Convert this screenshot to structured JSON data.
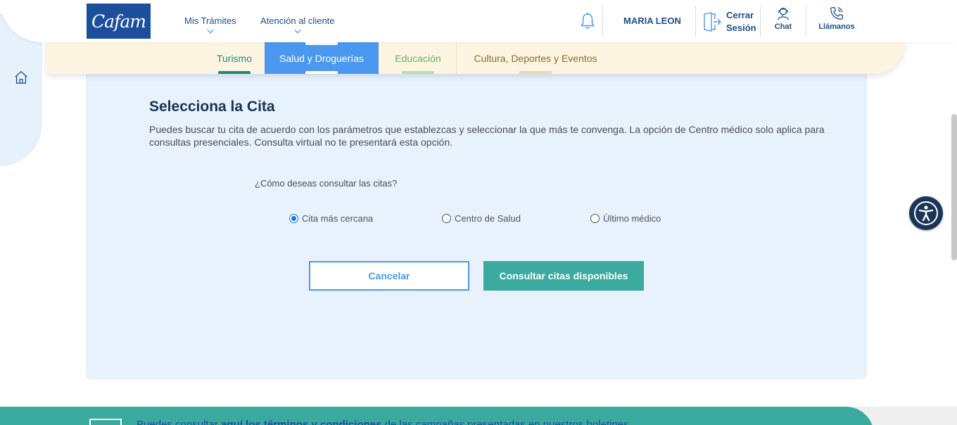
{
  "header": {
    "logo_text": "Cafam",
    "nav": [
      {
        "label": "Mis Trámites"
      },
      {
        "label": "Atención al cliente"
      }
    ],
    "user_name": "MARIA LEON",
    "logout_label": "Cerrar Sesión",
    "chat_label": "Chat",
    "call_label": "Llámanos"
  },
  "categories": [
    {
      "label": "Turismo",
      "color": "#1e8a7e"
    },
    {
      "label": "Salud y Droguerías",
      "color": "#ffffff",
      "active": true
    },
    {
      "label": "Educación",
      "color": "#5cb85c"
    },
    {
      "label": "Cultura, Deportes y Eventos",
      "color": "#8a6d1e"
    }
  ],
  "main": {
    "title": "Selecciona la Cita",
    "description": "Puedes buscar tu cita de acuerdo con los parámetros que establezcas y seleccionar la que más te convenga. La opción de Centro médico solo aplica para consultas presenciales. Consulta virtual no te presentará esta opción.",
    "question": "¿Cómo deseas consultar las citas?",
    "options": [
      {
        "label": "Cita más cercana",
        "checked": true
      },
      {
        "label": "Centro de Salud",
        "checked": false
      },
      {
        "label": "Último médico",
        "checked": false
      }
    ],
    "cancel_label": "Cancelar",
    "submit_label": "Consultar citas disponibles"
  },
  "banner": {
    "text_before": "Puedes consultar ",
    "text_bold": "aquí los términos y condiciones",
    "text_after": " de las campañas presentadas en nuestros boletines"
  },
  "colors": {
    "brand_blue": "#1b4f9c",
    "accent_blue": "#4a98f0",
    "teal": "#3aa99e",
    "card_bg": "#e7f2fd"
  },
  "icons": [
    "home-icon",
    "bell-icon",
    "logout-icon",
    "chat-agent-icon",
    "phone-icon",
    "accessibility-icon",
    "chevron-down-icon"
  ]
}
